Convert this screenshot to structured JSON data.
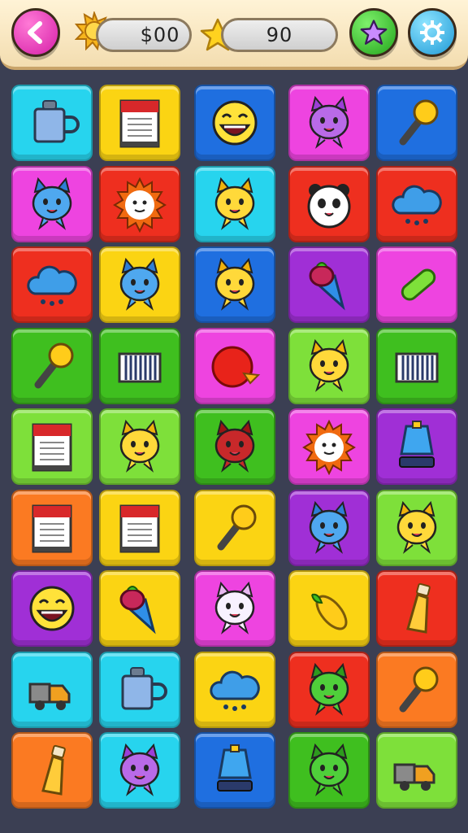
{
  "header": {
    "coins": "$00",
    "stars": "90",
    "back_icon": "back-arrow-icon",
    "favorite_icon": "star-icon",
    "settings_icon": "gear-icon"
  },
  "colors": {
    "cyan": "#27d4ee",
    "yellow": "#fbd413",
    "blue": "#1f6fe0",
    "magenta": "#ee44e0",
    "red": "#ee2f1f",
    "green": "#3fbf1f",
    "lime": "#7ee03a",
    "purple": "#a02fd6",
    "orange": "#fb7a22"
  },
  "board": {
    "rows": [
      [
        {
          "bg": "cyan",
          "icon": "mug"
        },
        {
          "bg": "yellow",
          "icon": "book"
        },
        {
          "bg": "blue",
          "icon": "laughing-face"
        },
        {
          "bg": "magenta",
          "icon": "purple-cat"
        },
        {
          "bg": "blue",
          "icon": "torch"
        }
      ],
      [
        {
          "bg": "magenta",
          "icon": "blue-cat"
        },
        {
          "bg": "red",
          "icon": "sun-face"
        },
        {
          "bg": "cyan",
          "icon": "yellow-cat"
        },
        {
          "bg": "red",
          "icon": "panda"
        },
        {
          "bg": "red",
          "icon": "cloud"
        }
      ],
      [
        {
          "bg": "red",
          "icon": "cloud"
        },
        {
          "bg": "yellow",
          "icon": "blue-cat"
        },
        {
          "bg": "blue",
          "icon": "yellow-cat"
        },
        {
          "bg": "purple",
          "icon": "ice-cream"
        },
        {
          "bg": "magenta",
          "icon": "pickle"
        }
      ],
      [
        {
          "bg": "green",
          "icon": "torch"
        },
        {
          "bg": "green",
          "icon": "cage"
        },
        {
          "bg": "magenta",
          "icon": "red-ball"
        },
        {
          "bg": "lime",
          "icon": "yellow-cat"
        },
        {
          "bg": "green",
          "icon": "cage"
        }
      ],
      [
        {
          "bg": "lime",
          "icon": "book"
        },
        {
          "bg": "lime",
          "icon": "yellow-cat"
        },
        {
          "bg": "green",
          "icon": "red-cat"
        },
        {
          "bg": "magenta",
          "icon": "sun-face"
        },
        {
          "bg": "purple",
          "icon": "lamp"
        }
      ],
      [
        {
          "bg": "orange",
          "icon": "book"
        },
        {
          "bg": "yellow",
          "icon": "book"
        },
        {
          "bg": "yellow",
          "icon": "torch"
        },
        {
          "bg": "purple",
          "icon": "blue-cat"
        },
        {
          "bg": "lime",
          "icon": "yellow-cat"
        }
      ],
      [
        {
          "bg": "purple",
          "icon": "laughing-face"
        },
        {
          "bg": "yellow",
          "icon": "ice-cream"
        },
        {
          "bg": "magenta",
          "icon": "white-cat"
        },
        {
          "bg": "yellow",
          "icon": "corn"
        },
        {
          "bg": "red",
          "icon": "bottle"
        }
      ],
      [
        {
          "bg": "cyan",
          "icon": "truck"
        },
        {
          "bg": "cyan",
          "icon": "mug"
        },
        {
          "bg": "yellow",
          "icon": "cloud"
        },
        {
          "bg": "red",
          "icon": "green-cat"
        },
        {
          "bg": "orange",
          "icon": "torch"
        }
      ],
      [
        {
          "bg": "orange",
          "icon": "bottle"
        },
        {
          "bg": "cyan",
          "icon": "purple-cat"
        },
        {
          "bg": "blue",
          "icon": "lamp"
        },
        {
          "bg": "green",
          "icon": "green-cat"
        },
        {
          "bg": "lime",
          "icon": "truck"
        }
      ]
    ]
  }
}
